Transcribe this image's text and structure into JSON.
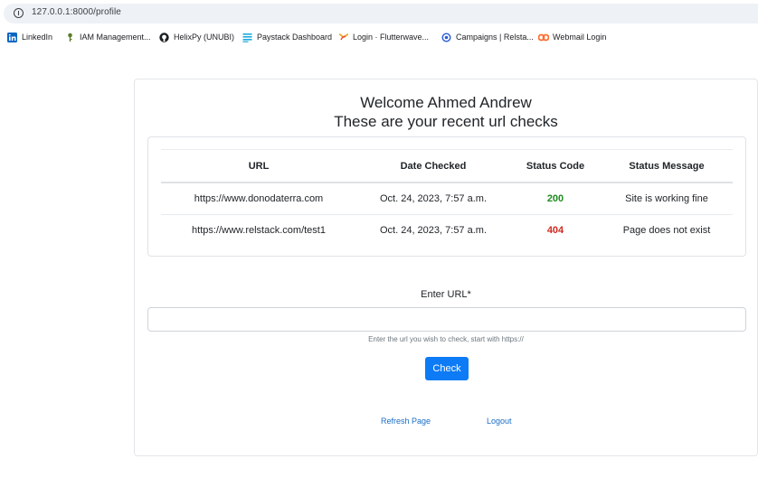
{
  "browser": {
    "url": "127.0.0.1:8000/profile",
    "bookmarks": [
      {
        "label": "LinkedIn",
        "icon": "linkedin-icon"
      },
      {
        "label": "IAM Management...",
        "icon": "key-icon"
      },
      {
        "label": "HelixPy (UNUBI)",
        "icon": "github-icon"
      },
      {
        "label": "Paystack Dashboard",
        "icon": "paystack-icon"
      },
      {
        "label": "Login · Flutterwave...",
        "icon": "flutterwave-icon"
      },
      {
        "label": "Campaigns | Relsta...",
        "icon": "relstack-icon"
      },
      {
        "label": "Webmail Login",
        "icon": "cpanel-icon"
      }
    ]
  },
  "page": {
    "welcome": "Welcome Ahmed Andrew",
    "subtitle": "These are your recent url checks",
    "table": {
      "headers": [
        "URL",
        "Date Checked",
        "Status Code",
        "Status Message"
      ],
      "rows": [
        {
          "url": "https://www.donodaterra.com",
          "date": "Oct. 24, 2023, 7:57 a.m.",
          "code": "200",
          "message": "Site is working fine"
        },
        {
          "url": "https://www.relstack.com/test1",
          "date": "Oct. 24, 2023, 7:57 a.m.",
          "code": "404",
          "message": "Page does not exist"
        }
      ]
    },
    "form": {
      "label": "Enter URL*",
      "input_value": "",
      "help": "Enter the url you wish to check, start with https://",
      "button": "Check"
    },
    "links": {
      "refresh": "Refresh Page",
      "logout": "Logout"
    }
  },
  "colors": {
    "primary": "#0d7bf5",
    "success": "#1f8a1f",
    "danger": "#d0281f",
    "link": "#1a6ec5"
  }
}
